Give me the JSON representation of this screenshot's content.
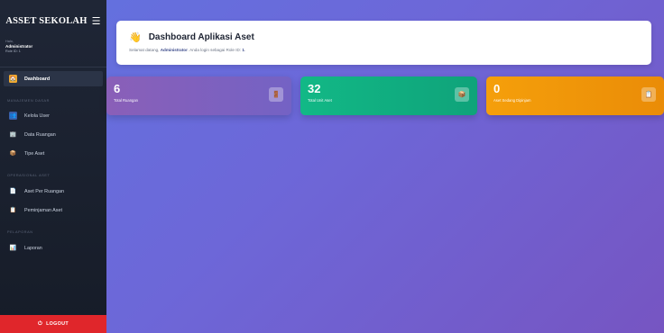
{
  "sidebar": {
    "brand": "ASSET SEKOLAH",
    "menu_icon": "☰",
    "user": {
      "label": "Halo,",
      "name": "Administrator",
      "role": "Role ID: 1"
    },
    "items": [
      {
        "label": "Dashboard",
        "icon": "🏠"
      },
      {
        "label": "Kelola User",
        "icon": "👥"
      },
      {
        "label": "Data Ruangan",
        "icon": "🏢"
      },
      {
        "label": "Tipe Aset",
        "icon": "📦"
      },
      {
        "label": "Aset Per Ruangan",
        "icon": "📄"
      },
      {
        "label": "Peminjaman Aset",
        "icon": "📋"
      },
      {
        "label": "Laporan",
        "icon": "📊"
      }
    ],
    "sections": [
      "MANAJEMEN DASAR",
      "OPERASIONAL ASET",
      "PELAPORAN"
    ],
    "logout": {
      "label": "LOGOUT",
      "icon": "⏻"
    }
  },
  "header": {
    "icon": "👋",
    "title": "Dashboard Aplikasi Aset",
    "subtitle_pre": "Selamat datang, ",
    "subtitle_user": "Administrator",
    "subtitle_mid": ". Anda login sebagai Role ID: ",
    "subtitle_role": "1",
    "subtitle_end": "."
  },
  "stats": [
    {
      "value": "6",
      "label": "Total Ruangan",
      "icon": "🚪",
      "color": "#7f60bf"
    },
    {
      "value": "32",
      "label": "Total Unit Aset",
      "icon": "📦",
      "color": "#12b886"
    },
    {
      "value": "0",
      "label": "Aset Sedang Dipinjam",
      "icon": "📋",
      "color": "#f59f0b"
    }
  ],
  "colors": {
    "sidebar_bg": "#1b2130",
    "logout_bg": "#e0262b",
    "main_bg_start": "#6470de",
    "main_bg_end": "#7655c2"
  }
}
